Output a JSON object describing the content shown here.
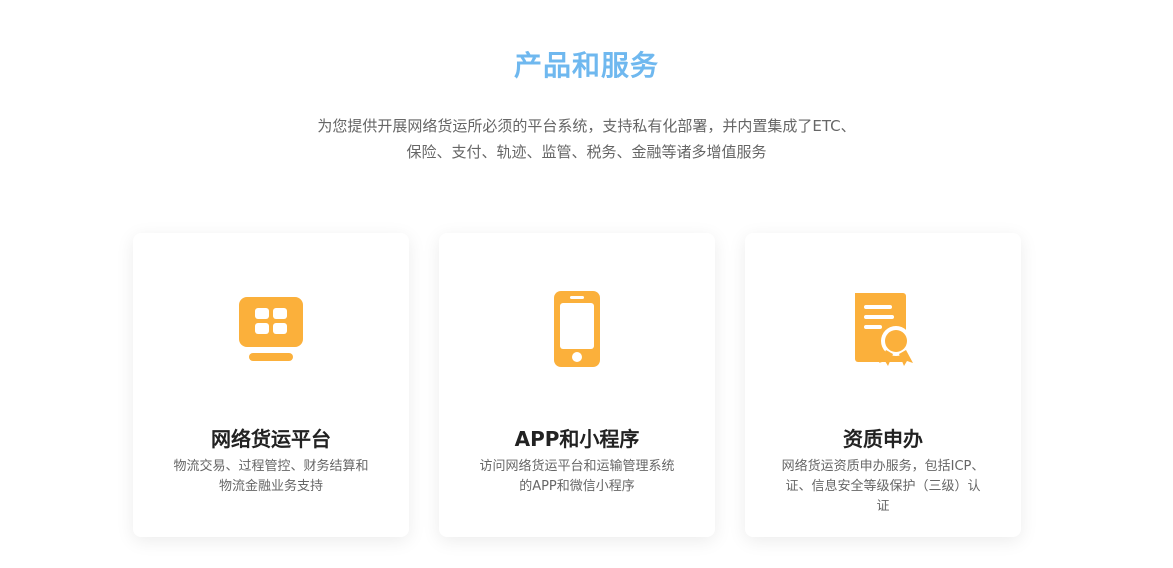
{
  "section": {
    "title": "产品和服务",
    "subtitle_line1": "为您提供开展网络货运所必须的平台系统，支持私有化部署，并内置集成了ETC、",
    "subtitle_line2": "保险、支付、轨迹、监管、税务、金融等诸多增值服务"
  },
  "colors": {
    "title": "#6fb8ef",
    "icon": "#fbb03b",
    "text": "#222222",
    "muted": "#666666"
  },
  "cards": [
    {
      "icon": "platform-grid-icon",
      "title": "网络货运平台",
      "desc_line1": "物流交易、过程管控、财务结算和",
      "desc_line2": "物流金融业务支持"
    },
    {
      "icon": "mobile-phone-icon",
      "title": "APP和小程序",
      "desc_line1": "访问网络货运平台和运输管理系统",
      "desc_line2": "的APP和微信小程序"
    },
    {
      "icon": "certificate-award-icon",
      "title": "资质申办",
      "desc_line1": "网络货运资质申办服务，包括ICP、",
      "desc_line2": "证、信息安全等级保护（三级）认",
      "desc_line3": "证"
    }
  ]
}
